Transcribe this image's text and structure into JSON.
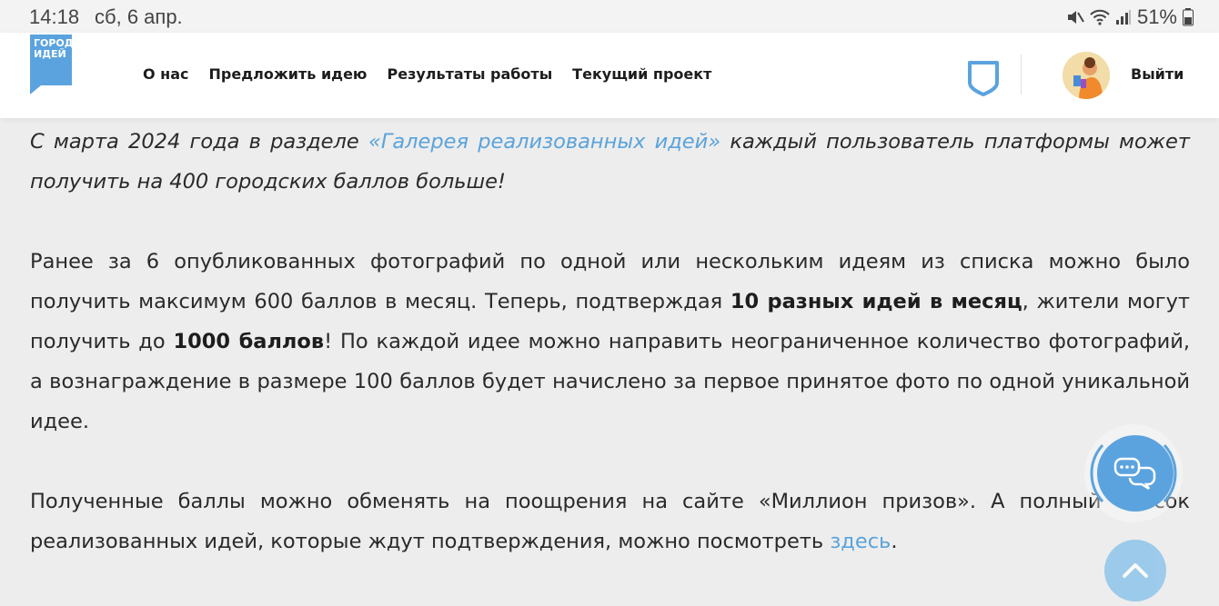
{
  "status": {
    "time": "14:18",
    "date": "сб, 6 апр.",
    "battery": "51%"
  },
  "header": {
    "logo_line1": "ГОРОД",
    "logo_line2": "ИДЕЙ",
    "nav": [
      {
        "label": "О нас"
      },
      {
        "label": "Предложить идею"
      },
      {
        "label": "Результаты работы"
      },
      {
        "label": "Текущий проект"
      }
    ],
    "logout_label": "Выйти"
  },
  "content": {
    "p1": {
      "before": "С марта 2024 года в разделе ",
      "link": "«Галерея реализованных идей»",
      "after": " каждый пользователь платформы может получить на 400 городских баллов больше!"
    },
    "p2": {
      "t1": "Ранее за 6 опубликованных фотографий по одной или нескольким идеям из списка можно было получить максимум 600 баллов в месяц. Теперь, подтверждая ",
      "b1": "10 разных идей в месяц",
      "t2": ", жители могут получить до ",
      "b2": "1000 баллов",
      "t3": "! По каждой идее можно направить неограниченное количество фотографий, а вознаграждение в размере 100 баллов будет начислено за первое принятое фото по одной уникальной идее."
    },
    "p3": {
      "t1": "Полученные баллы можно обменять на поощрения на сайте «Миллион призов». А полный список реализованных идей, которые ждут подтверждения, можно посмотреть ",
      "link": "здесь",
      "t2": "."
    }
  },
  "colors": {
    "accent": "#5ba3de",
    "link": "#5aa3db",
    "background": "#ededed"
  },
  "icons": {
    "shield": "shield-icon",
    "chat": "chat-bubbles-icon",
    "scroll_up": "chevron-up-icon"
  }
}
